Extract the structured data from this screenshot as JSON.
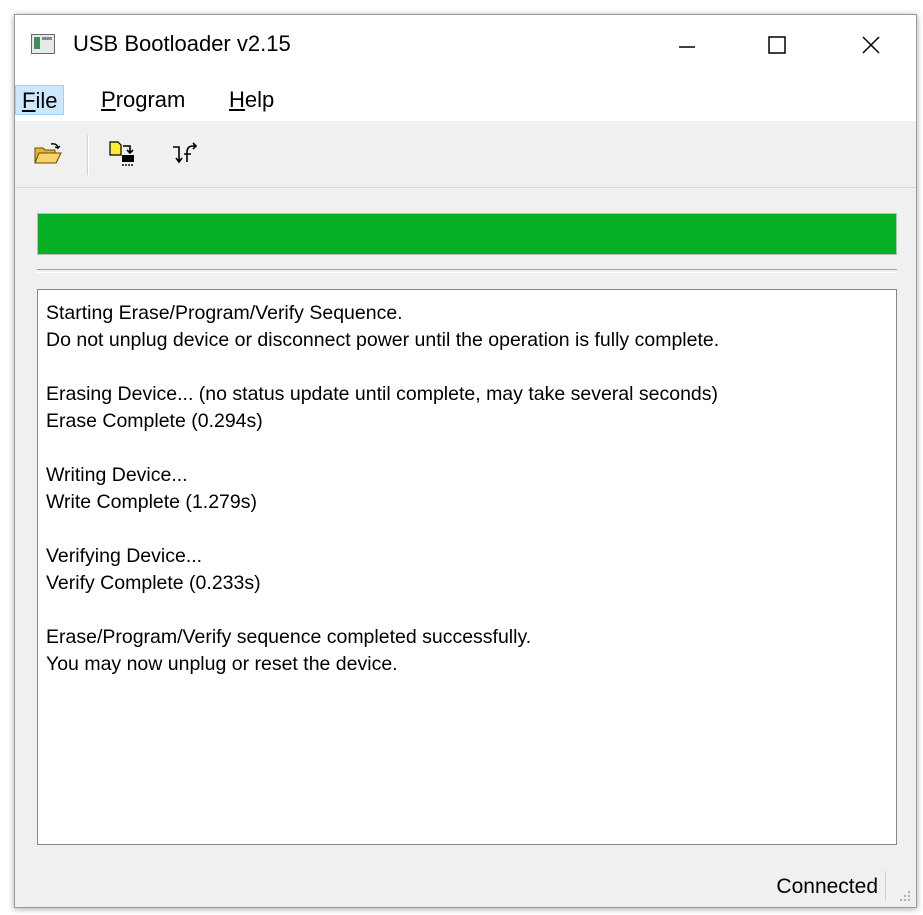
{
  "window": {
    "title": "USB Bootloader v2.15"
  },
  "menu": [
    {
      "mnemonic": "F",
      "rest": "ile"
    },
    {
      "mnemonic": "P",
      "rest": "rogram"
    },
    {
      "mnemonic": "H",
      "rest": "elp"
    }
  ],
  "toolbar": {
    "icons": [
      "open-folder-icon",
      "program-device-icon",
      "reset-device-icon"
    ]
  },
  "progress": {
    "value": 1.0,
    "color": "#06b025"
  },
  "log": {
    "lines": [
      "Starting Erase/Program/Verify Sequence.",
      "Do not unplug device or disconnect power until the operation is fully complete.",
      "",
      "Erasing Device... (no status update until complete, may take several seconds)",
      "Erase Complete (0.294s)",
      "",
      "Writing Device...",
      "Write Complete (1.279s)",
      "",
      "Verifying Device...",
      "Verify Complete (0.233s)",
      "",
      "Erase/Program/Verify sequence completed successfully.",
      "You may now unplug or reset the device."
    ]
  },
  "statusbar": {
    "text": "Connected"
  }
}
